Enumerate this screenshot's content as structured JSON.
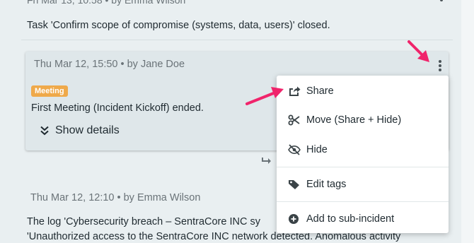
{
  "top_entry": {
    "meta": "Fri Mar 13, 10:58 • by Emma Wilson",
    "text": "Task 'Confirm scope of compromise (systems, data, users)' closed."
  },
  "card": {
    "meta": "Thu Mar 12, 15:50 • by Jane Doe",
    "badge": "Meeting",
    "text": "First Meeting (Incident Kickoff) ended.",
    "show_details": "Show details"
  },
  "second_entry": {
    "meta": "Thu Mar 12, 12:10 • by Emma Wilson",
    "line1": "The log 'Cybersecurity breach – SentraCore INC sy",
    "line2": "'Unauthorized access to the SentraCore INC network detected. Anomalous activity"
  },
  "menu": {
    "items": [
      {
        "label": "Share",
        "icon": "share-icon"
      },
      {
        "label": "Move (Share + Hide)",
        "icon": "scissors-icon"
      },
      {
        "label": "Hide",
        "icon": "eye-slash-icon"
      },
      {
        "label": "Edit tags",
        "icon": "tag-icon"
      },
      {
        "label": "Add to sub-incident",
        "icon": "plus-circle-icon"
      }
    ]
  },
  "colors": {
    "badge": "#efa94a",
    "annotation_arrow": "#f0246b",
    "background": "#e9eff1",
    "card": "#dfe7ea"
  }
}
